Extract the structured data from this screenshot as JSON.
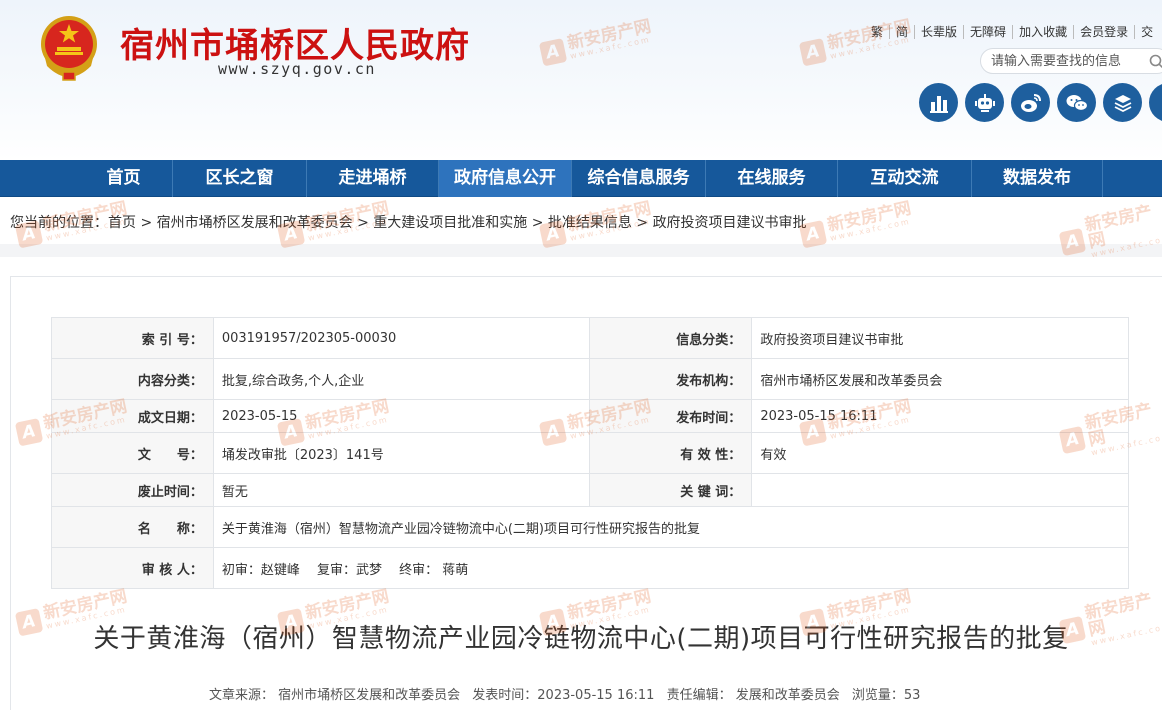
{
  "header": {
    "title": "宿州市埇桥区人民政府",
    "url": "www.szyq.gov.cn",
    "top_links": [
      "繁",
      "简",
      "长辈版",
      "无障碍",
      "加入收藏",
      "会员登录",
      "交"
    ],
    "search_placeholder": "请输入需要查找的信息",
    "social_icons": [
      "stats-icon",
      "robot-icon",
      "weibo-icon",
      "wechat-icon",
      "layers-icon",
      "more-icon"
    ]
  },
  "nav": {
    "items": [
      "首页",
      "区长之窗",
      "走进埇桥",
      "政府信息公开",
      "综合信息服务",
      "在线服务",
      "互动交流",
      "数据发布"
    ],
    "active_index": 3
  },
  "breadcrumb": {
    "prefix": "您当前的位置：",
    "items": [
      "首页",
      "宿州市埇桥区发展和改革委员会",
      "重大建设项目批准和实施",
      "批准结果信息",
      "政府投资项目建议书审批"
    ],
    "separator": ">"
  },
  "meta": {
    "index_label": "索 引 号：",
    "index_value": "003191957/202305-00030",
    "info_cat_label": "信息分类：",
    "info_cat_value": "政府投资项目建议书审批",
    "content_cat_label": "内容分类：",
    "content_cat_value": "批复,综合政务,个人,企业",
    "publisher_label": "发布机构：",
    "publisher_value": "宿州市埇桥区发展和改革委员会",
    "created_label": "成文日期：",
    "created_value": "2023-05-15",
    "published_label": "发布时间：",
    "published_value": "2023-05-15 16:11",
    "docno_label": "文　　号：",
    "docno_value": "埇发改审批〔2023〕141号",
    "validity_label": "有 效 性：",
    "validity_value": "有效",
    "abolish_label": "废止时间：",
    "abolish_value": "暂无",
    "keywords_label": "关 键 词：",
    "keywords_value": "",
    "name_label": "名　　称：",
    "name_value": "关于黄淮海（宿州）智慧物流产业园冷链物流中心(二期)项目可行性研究报告的批复",
    "reviewer_label": "审 核 人：",
    "reviewer_value": "初审：赵键峰　 复审：武梦　 终审： 蒋萌"
  },
  "article": {
    "title": "关于黄淮海（宿州）智慧物流产业园冷链物流中心(二期)项目可行性研究报告的批复",
    "source": "文章来源： 宿州市埇桥区发展和改革委员会",
    "time": "发表时间：2023-05-15 16:11",
    "editor": "责任编辑： 发展和改革委员会",
    "views": "浏览量：53"
  },
  "watermark": {
    "logo": "A",
    "text": "新安房产网",
    "sub": "www.xafc.com"
  },
  "colors": {
    "nav": "#16589b",
    "nav_active": "#2e73bd",
    "title_red": "#cc1111",
    "icon_blue": "#1e5f9e",
    "watermark": "#e05a1a"
  }
}
